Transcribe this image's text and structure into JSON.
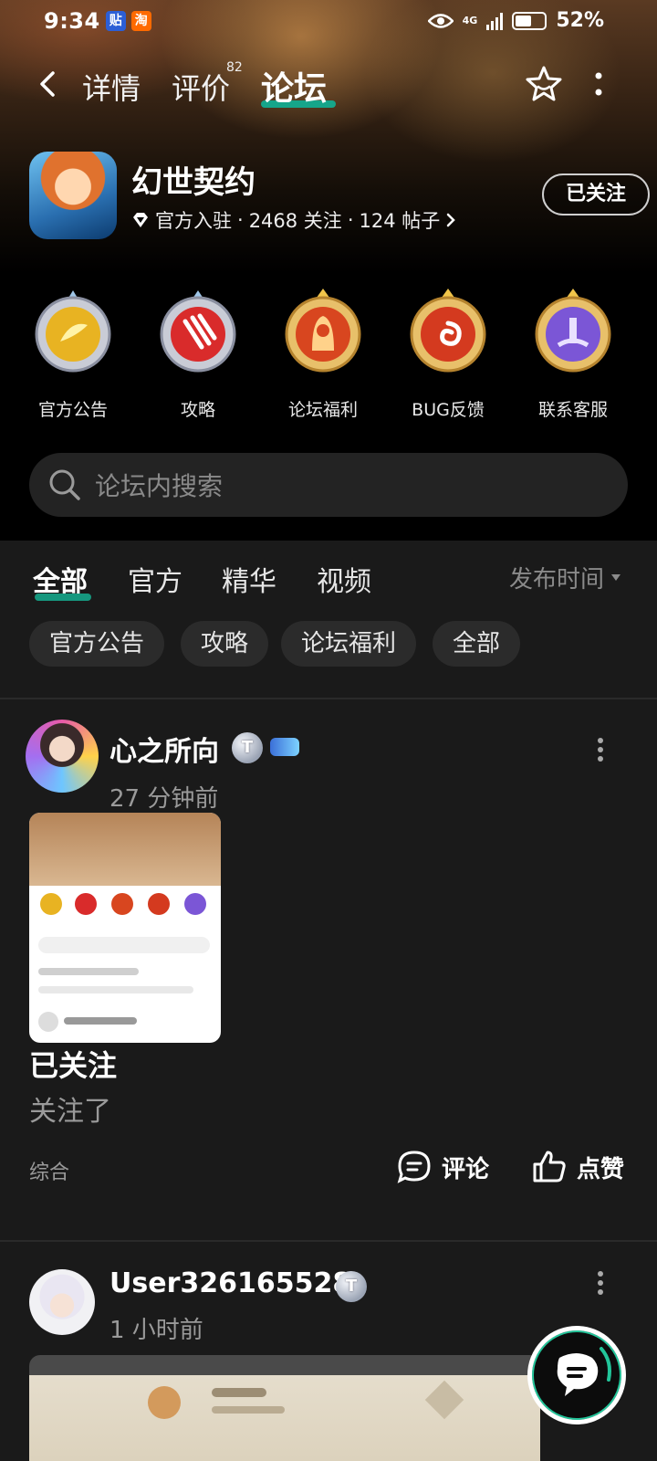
{
  "status_bar": {
    "time": "9:34",
    "app_icon_1": "贴",
    "app_icon_2": "淘",
    "network": "4G",
    "battery": "52%"
  },
  "nav": {
    "tabs": [
      {
        "label": "详情"
      },
      {
        "label": "评价",
        "badge": "82"
      },
      {
        "label": "论坛"
      }
    ]
  },
  "game": {
    "title": "幻世契约",
    "official": "官方入驻",
    "followers": "2468 关注",
    "posts": "124 帖子",
    "sep": "·",
    "follow_label": "已关注"
  },
  "categories": [
    {
      "label": "官方公告",
      "color": "#e8b322"
    },
    {
      "label": "攻略",
      "color": "#d92b2b"
    },
    {
      "label": "论坛福利",
      "color": "#d8461f"
    },
    {
      "label": "BUG反馈",
      "color": "#d43a1f"
    },
    {
      "label": "联系客服",
      "color": "#7b56d6"
    }
  ],
  "search": {
    "placeholder": "论坛内搜索"
  },
  "filters": {
    "tabs": [
      "全部",
      "官方",
      "精华",
      "视频"
    ],
    "sort": "发布时间",
    "chips": [
      "官方公告",
      "攻略",
      "论坛福利",
      "全部"
    ]
  },
  "posts": [
    {
      "author": "心之所向",
      "level": "T",
      "time": "27 分钟前",
      "title": "已关注",
      "body": "关注了",
      "tag": "综合",
      "comment_label": "评论",
      "like_label": "点赞"
    },
    {
      "author": "User326165528",
      "level": "T",
      "time": "1 小时前"
    }
  ],
  "colors": {
    "accent": "#16a58a",
    "background": "#1a1a1a"
  }
}
